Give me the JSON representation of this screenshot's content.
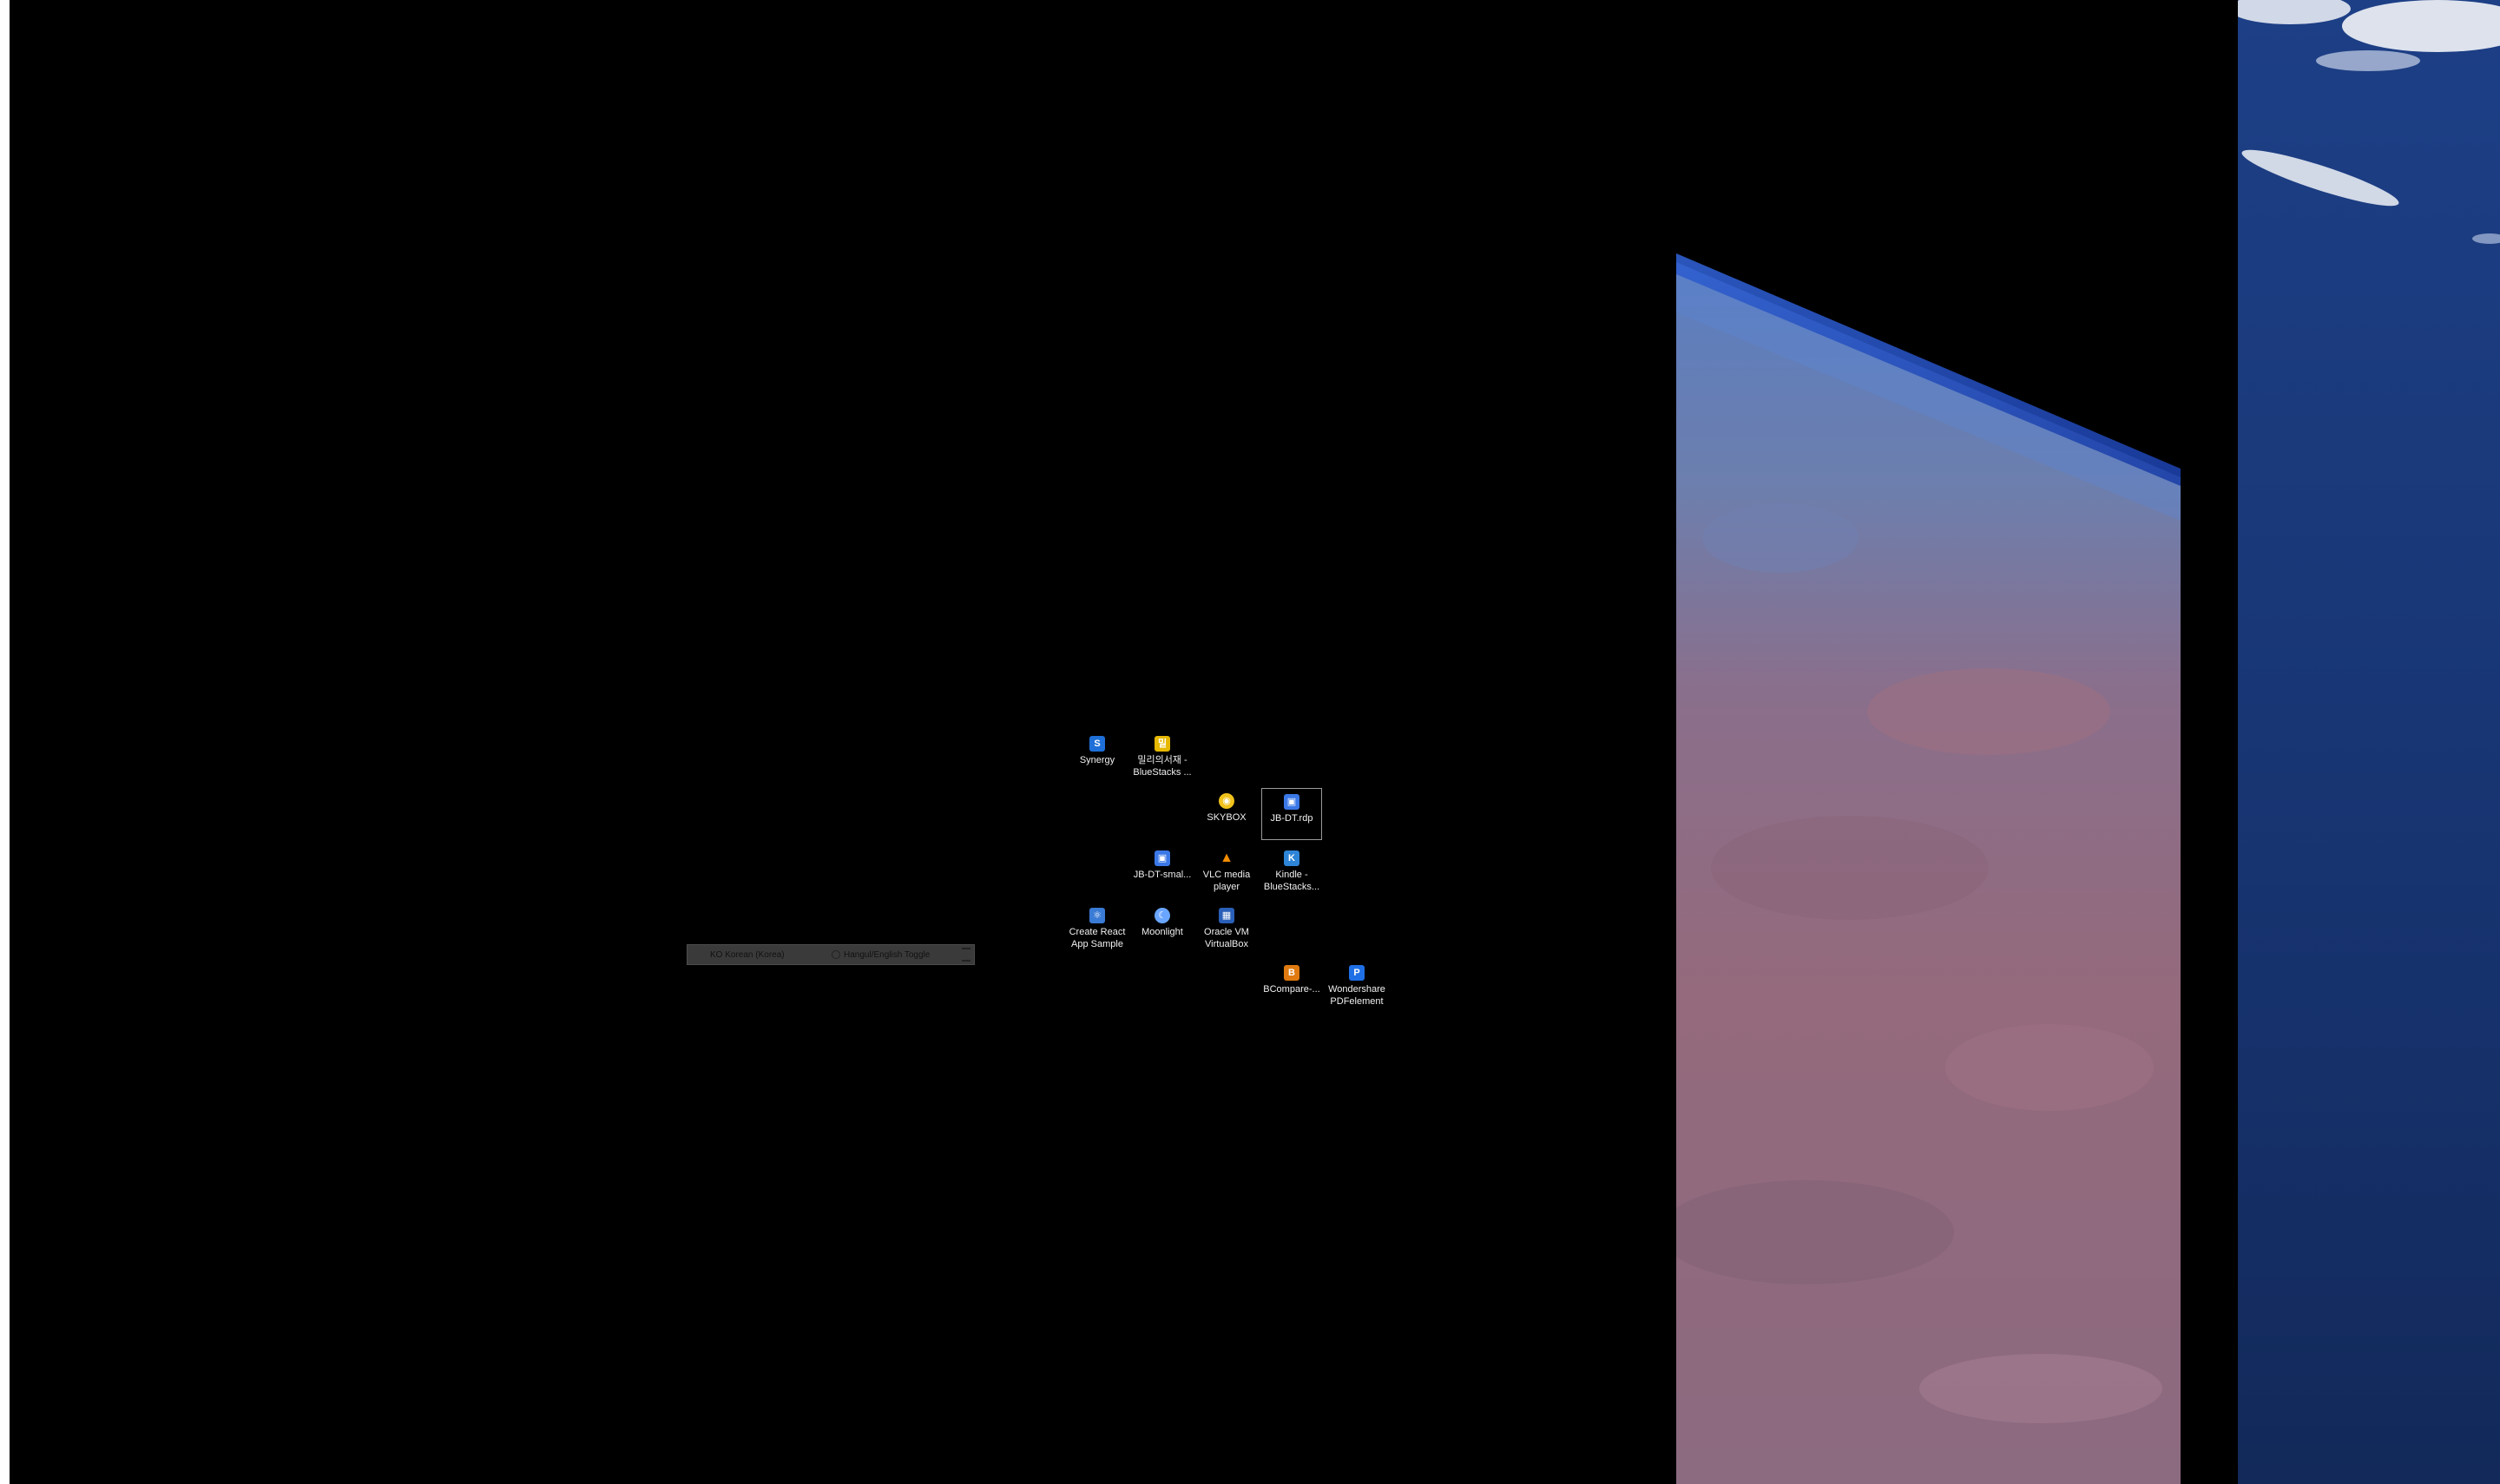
{
  "colors": {
    "desktop_background": "#000000",
    "language_bar_background": "#3a3a3a",
    "icon_label_text": "#f0f0f0",
    "ocean": "#1d3f86"
  },
  "desktop_icons": [
    {
      "id": "synergy",
      "label": "Synergy",
      "icon": "synergy-icon",
      "color": "#1e6fd8"
    },
    {
      "id": "millie",
      "label": "밀리의서재 -\nBlueStacks ...",
      "icon": "bluestacks-app-icon",
      "color": "#e6b800"
    },
    {
      "id": "skybox",
      "label": "SKYBOX",
      "icon": "skybox-icon",
      "color": "#f1c21b"
    },
    {
      "id": "jbdt-rdp",
      "label": "JB-DT.rdp",
      "icon": "remote-desktop-icon",
      "color": "#3b78e7",
      "selected": true
    },
    {
      "id": "jbdt-small",
      "label": "JB-DT-smal...",
      "icon": "remote-desktop-icon",
      "color": "#3b78e7"
    },
    {
      "id": "vlc",
      "label": "VLC media\nplayer",
      "icon": "vlc-cone-icon",
      "color": "#f28c00"
    },
    {
      "id": "kindle",
      "label": "Kindle -\nBlueStacks...",
      "icon": "kindle-bluestacks-icon",
      "color": "#2e84d6"
    },
    {
      "id": "create-react",
      "label": "Create React\nApp Sample",
      "icon": "app-shortcut-icon",
      "color": "#3a7bd5"
    },
    {
      "id": "moonlight",
      "label": "Moonlight",
      "icon": "moonlight-icon",
      "color": "#6aa6ff"
    },
    {
      "id": "virtualbox",
      "label": "Oracle VM\nVirtualBox",
      "icon": "virtualbox-icon",
      "color": "#2a5fb8"
    },
    {
      "id": "bcompare",
      "label": "BCompare-...",
      "icon": "bcompare-icon",
      "color": "#e07a10"
    },
    {
      "id": "pdfelement",
      "label": "Wondershare\nPDFelement",
      "icon": "pdfelement-icon",
      "color": "#1f6fe5"
    }
  ],
  "language_bar": {
    "language": "KO Korean (Korea)",
    "input_mode": "Hangul/English Toggle",
    "toggle_icon": "ime-toggle-icon",
    "grip_icon": "grip-handle-icon"
  }
}
